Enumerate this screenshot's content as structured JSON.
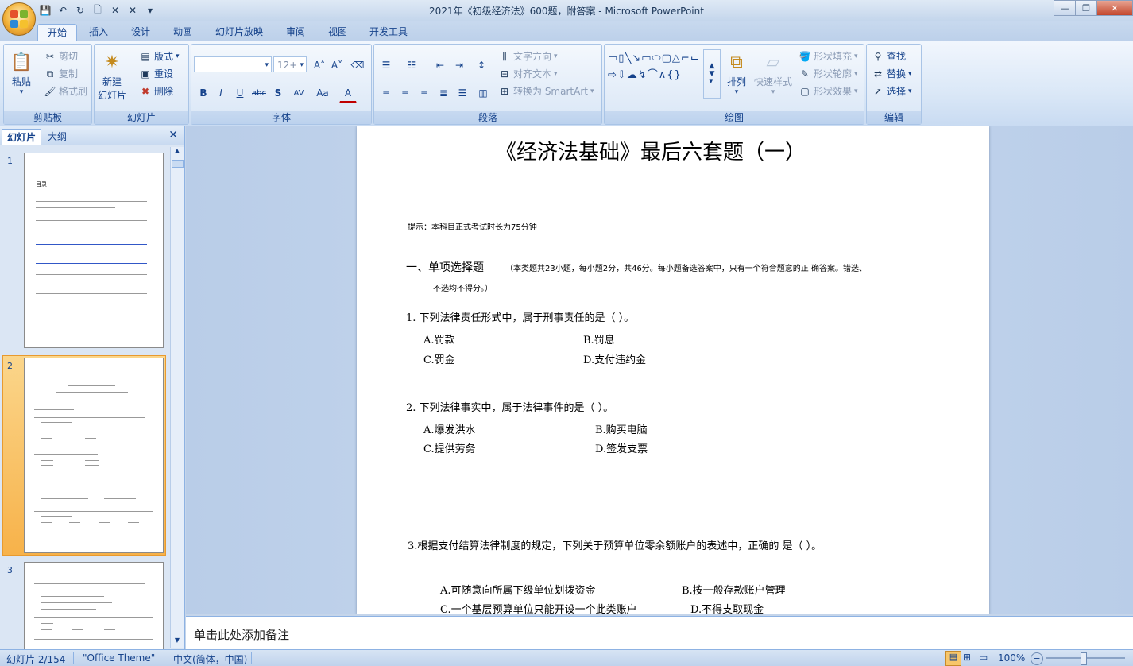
{
  "window": {
    "title": "2021年《初级经济法》600题，附答案 - Microsoft PowerPoint"
  },
  "ribbon_tabs": [
    "开始",
    "插入",
    "设计",
    "动画",
    "幻灯片放映",
    "审阅",
    "视图",
    "开发工具"
  ],
  "clipboard": {
    "paste": "粘贴",
    "cut": "剪切",
    "copy": "复制",
    "format_painter": "格式刷",
    "label": "剪贴板"
  },
  "slides_group": {
    "new_slide": "新建",
    "new_slide2": "幻灯片",
    "layout": "版式",
    "reset": "重设",
    "delete": "删除",
    "label": "幻灯片"
  },
  "font_group": {
    "font_size": "12+",
    "label": "字体"
  },
  "paragraph_group": {
    "text_direction": "文字方向",
    "align_text": "对齐文本",
    "convert_smartart": "转换为 SmartArt",
    "label": "段落"
  },
  "drawing_group": {
    "arrange": "排列",
    "quick_styles": "快速样式",
    "shape_fill": "形状填充",
    "shape_outline": "形状轮廓",
    "shape_effects": "形状效果",
    "label": "绘图"
  },
  "editing_group": {
    "find": "查找",
    "replace": "替换",
    "select": "选择",
    "label": "编辑"
  },
  "panel": {
    "tab_slides": "幻灯片",
    "tab_outline": "大纲",
    "thumb1": "1",
    "thumb2": "2",
    "thumb3": "3",
    "thumb1_title": "目录"
  },
  "slide": {
    "title": "《经济法基础》最后六套题（一）",
    "hint": "提示：本科目正式考试时长为75分钟",
    "section_title": "一、单项选择题",
    "section_desc": "（本类题共23小题，每小题2分，共46分。每小题备选答案中，只有一个符合题意的正 确答案。错选、",
    "section_desc2": "不选均不得分。）",
    "q1": "1. 下列法律责任形式中，属于刑事责任的是（ ）。",
    "q1a": "A.罚款",
    "q1b": "B.罚息",
    "q1c": "C.罚金",
    "q1d": "D.支付违约金",
    "q2": "2. 下列法律事实中，属于法律事件的是（ ）。",
    "q2a": "A.爆发洪水",
    "q2b": "B.购买电脑",
    "q2c": "C.提供劳务",
    "q2d": "D.签发支票",
    "q3": "3.根据支付结算法律制度的规定，下列关于预算单位零余额账户的表述中，正确的 是（ ）。",
    "q3a": "A.可随意向所属下级单位划拨资金",
    "q3b": "B.按一般存款账户管理",
    "q3c": "C.一个基层预算单位只能开设一个此类账户",
    "q3d": "D.不得支取现金"
  },
  "notes": {
    "placeholder": "单击此处添加备注"
  },
  "status": {
    "slide": "幻灯片 2/154",
    "theme": "\"Office Theme\"",
    "language": "中文(简体，中国)",
    "zoom": "100%"
  }
}
